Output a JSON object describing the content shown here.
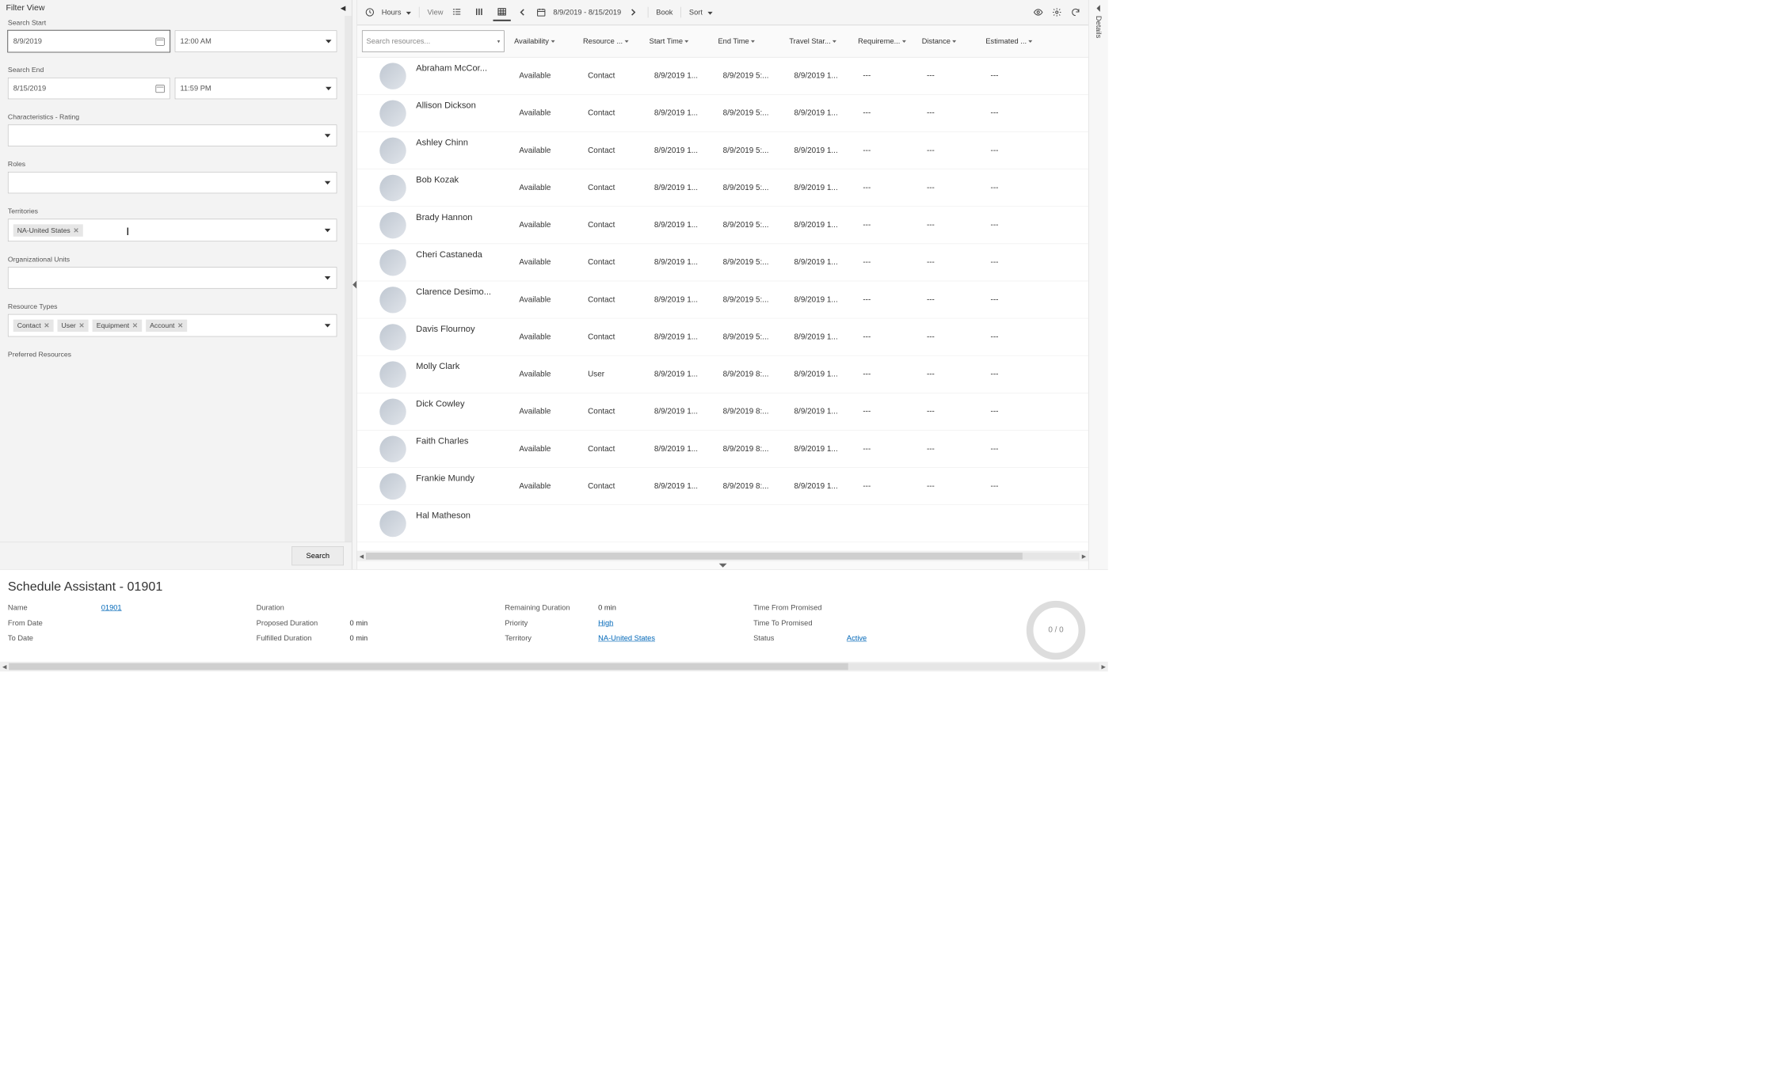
{
  "filter": {
    "title": "Filter View",
    "search_start_label": "Search Start",
    "search_start_date": "8/9/2019",
    "search_start_time": "12:00 AM",
    "search_end_label": "Search End",
    "search_end_date": "8/15/2019",
    "search_end_time": "11:59 PM",
    "characteristics_label": "Characteristics - Rating",
    "roles_label": "Roles",
    "territories_label": "Territories",
    "territories_tags": [
      "NA-United States"
    ],
    "org_units_label": "Organizational Units",
    "resource_types_label": "Resource Types",
    "resource_types_tags": [
      "Contact",
      "User",
      "Equipment",
      "Account"
    ],
    "preferred_resources_label": "Preferred Resources",
    "search_button": "Search"
  },
  "toolbar": {
    "hours_label": "Hours",
    "view_label": "View",
    "date_range": "8/9/2019 - 8/15/2019",
    "book_label": "Book",
    "sort_label": "Sort"
  },
  "grid": {
    "search_placeholder": "Search resources...",
    "columns": [
      "Availability",
      "Resource ...",
      "Start Time",
      "End Time",
      "Travel Star...",
      "Requireme...",
      "Distance",
      "Estimated ..."
    ],
    "rows": [
      {
        "name": "Abraham McCor...",
        "avail": "Available",
        "type": "Contact",
        "start": "8/9/2019 1...",
        "end": "8/9/2019 5:...",
        "travel": "8/9/2019 1...",
        "req": "---",
        "dist": "---",
        "est": "---"
      },
      {
        "name": "Allison Dickson",
        "avail": "Available",
        "type": "Contact",
        "start": "8/9/2019 1...",
        "end": "8/9/2019 5:...",
        "travel": "8/9/2019 1...",
        "req": "---",
        "dist": "---",
        "est": "---"
      },
      {
        "name": "Ashley Chinn",
        "avail": "Available",
        "type": "Contact",
        "start": "8/9/2019 1...",
        "end": "8/9/2019 5:...",
        "travel": "8/9/2019 1...",
        "req": "---",
        "dist": "---",
        "est": "---"
      },
      {
        "name": "Bob Kozak",
        "avail": "Available",
        "type": "Contact",
        "start": "8/9/2019 1...",
        "end": "8/9/2019 5:...",
        "travel": "8/9/2019 1...",
        "req": "---",
        "dist": "---",
        "est": "---"
      },
      {
        "name": "Brady Hannon",
        "avail": "Available",
        "type": "Contact",
        "start": "8/9/2019 1...",
        "end": "8/9/2019 5:...",
        "travel": "8/9/2019 1...",
        "req": "---",
        "dist": "---",
        "est": "---"
      },
      {
        "name": "Cheri Castaneda",
        "avail": "Available",
        "type": "Contact",
        "start": "8/9/2019 1...",
        "end": "8/9/2019 5:...",
        "travel": "8/9/2019 1...",
        "req": "---",
        "dist": "---",
        "est": "---"
      },
      {
        "name": "Clarence Desimo...",
        "avail": "Available",
        "type": "Contact",
        "start": "8/9/2019 1...",
        "end": "8/9/2019 5:...",
        "travel": "8/9/2019 1...",
        "req": "---",
        "dist": "---",
        "est": "---"
      },
      {
        "name": "Davis Flournoy",
        "avail": "Available",
        "type": "Contact",
        "start": "8/9/2019 1...",
        "end": "8/9/2019 5:...",
        "travel": "8/9/2019 1...",
        "req": "---",
        "dist": "---",
        "est": "---"
      },
      {
        "name": "Molly Clark",
        "avail": "Available",
        "type": "User",
        "start": "8/9/2019 1...",
        "end": "8/9/2019 8:...",
        "travel": "8/9/2019 1...",
        "req": "---",
        "dist": "---",
        "est": "---"
      },
      {
        "name": "Dick Cowley",
        "avail": "Available",
        "type": "Contact",
        "start": "8/9/2019 1...",
        "end": "8/9/2019 8:...",
        "travel": "8/9/2019 1...",
        "req": "---",
        "dist": "---",
        "est": "---"
      },
      {
        "name": "Faith Charles",
        "avail": "Available",
        "type": "Contact",
        "start": "8/9/2019 1...",
        "end": "8/9/2019 8:...",
        "travel": "8/9/2019 1...",
        "req": "---",
        "dist": "---",
        "est": "---"
      },
      {
        "name": "Frankie Mundy",
        "avail": "Available",
        "type": "Contact",
        "start": "8/9/2019 1...",
        "end": "8/9/2019 8:...",
        "travel": "8/9/2019 1...",
        "req": "---",
        "dist": "---",
        "est": "---"
      },
      {
        "name": "Hal Matheson",
        "avail": "",
        "type": "",
        "start": "",
        "end": "",
        "travel": "",
        "req": "",
        "dist": "",
        "est": ""
      }
    ]
  },
  "details_tab": "Details",
  "detail": {
    "title": "Schedule Assistant - 01901",
    "name_label": "Name",
    "name_value": "01901",
    "from_date_label": "From Date",
    "from_date_value": "",
    "to_date_label": "To Date",
    "to_date_value": "",
    "duration_label": "Duration",
    "duration_value": "",
    "proposed_duration_label": "Proposed Duration",
    "proposed_duration_value": "0 min",
    "fulfilled_duration_label": "Fulfilled Duration",
    "fulfilled_duration_value": "0 min",
    "remaining_duration_label": "Remaining Duration",
    "remaining_duration_value": "0 min",
    "priority_label": "Priority",
    "priority_value": "High",
    "territory_label": "Territory",
    "territory_value": "NA-United States",
    "time_from_promised_label": "Time From Promised",
    "time_from_promised_value": "",
    "time_to_promised_label": "Time To Promised",
    "time_to_promised_value": "",
    "status_label": "Status",
    "status_value": "Active",
    "ring_text": "0 / 0"
  }
}
